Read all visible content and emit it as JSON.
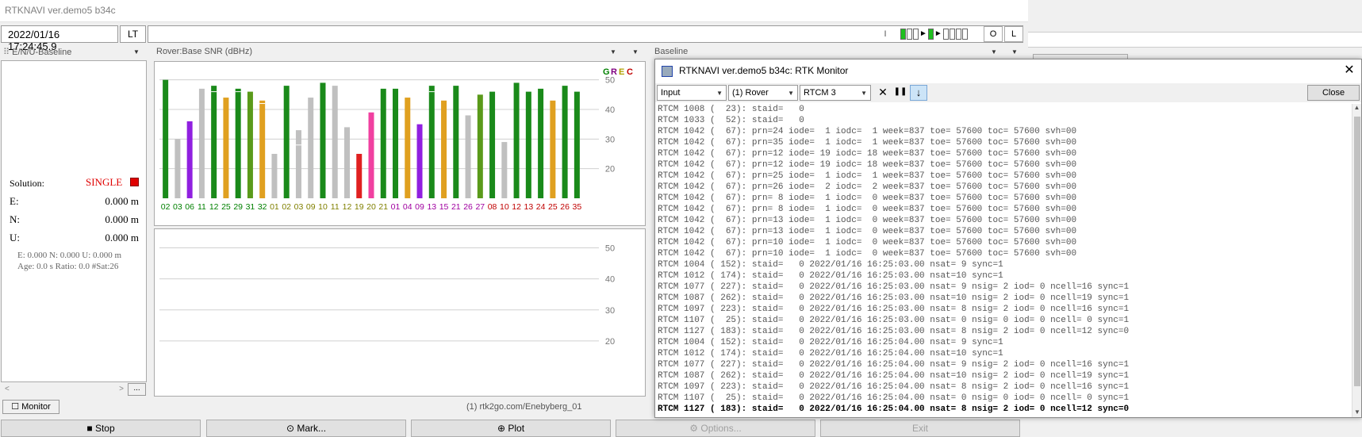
{
  "main_title": "RTKNAVI ver.demo5 b34c",
  "datetime": "2022/01/16 17:24:45.9",
  "time_mode": "LT",
  "status_btn": "I",
  "o_btn": "O",
  "l_btn": "L",
  "left_panel_title": "E/N/U-Baseline",
  "solution_label": "Solution:",
  "solution_value": "SINGLE",
  "e_label": "E:",
  "e_value": "0.000 m",
  "n_label": "N:",
  "n_value": "0.000 m",
  "u_label": "U:",
  "u_value": "0.000 m",
  "info_line1": "E: 0.000 N: 0.000 U: 0.000 m",
  "info_line2": "Age: 0.0 s Ratio: 0.0 #Sat:26",
  "more_btn": "...",
  "snr_title": "Rover:Base  SNR (dBHz)",
  "baseline_title": "Baseline",
  "monitor_btn": "Monitor",
  "stream_info": "(1) rtk2go.com/Enebyberg_01",
  "buttons": {
    "stop": "Stop",
    "mark": "Mark...",
    "plot": "Plot",
    "options": "Options...",
    "exit": "Exit"
  },
  "monitor": {
    "title": "RTKNAVI ver.demo5 b34c: RTK Monitor",
    "input_sel": "Input",
    "rover_sel": "(1) Rover",
    "format_sel": "RTCM 3",
    "close_btn": "Close",
    "log": [
      "RTCM 1008 (  23): staid=   0",
      "RTCM 1033 (  52): staid=   0",
      "RTCM 1042 (  67): prn=24 iode=  1 iodc=  1 week=837 toe= 57600 toc= 57600 svh=00",
      "RTCM 1042 (  67): prn=35 iode=  1 iodc=  1 week=837 toe= 57600 toc= 57600 svh=00",
      "RTCM 1042 (  67): prn=12 iode= 19 iodc= 18 week=837 toe= 57600 toc= 57600 svh=00",
      "RTCM 1042 (  67): prn=12 iode= 19 iodc= 18 week=837 toe= 57600 toc= 57600 svh=00",
      "RTCM 1042 (  67): prn=25 iode=  1 iodc=  1 week=837 toe= 57600 toc= 57600 svh=00",
      "RTCM 1042 (  67): prn=26 iode=  2 iodc=  2 week=837 toe= 57600 toc= 57600 svh=00",
      "RTCM 1042 (  67): prn= 8 iode=  1 iodc=  0 week=837 toe= 57600 toc= 57600 svh=00",
      "RTCM 1042 (  67): prn= 8 iode=  1 iodc=  0 week=837 toe= 57600 toc= 57600 svh=00",
      "RTCM 1042 (  67): prn=13 iode=  1 iodc=  0 week=837 toe= 57600 toc= 57600 svh=00",
      "RTCM 1042 (  67): prn=13 iode=  1 iodc=  0 week=837 toe= 57600 toc= 57600 svh=00",
      "RTCM 1042 (  67): prn=10 iode=  1 iodc=  0 week=837 toe= 57600 toc= 57600 svh=00",
      "RTCM 1042 (  67): prn=10 iode=  1 iodc=  0 week=837 toe= 57600 toc= 57600 svh=00",
      "RTCM 1004 ( 152): staid=   0 2022/01/16 16:25:03.00 nsat= 9 sync=1",
      "RTCM 1012 ( 174): staid=   0 2022/01/16 16:25:03.00 nsat=10 sync=1",
      "RTCM 1077 ( 227): staid=   0 2022/01/16 16:25:03.00 nsat= 9 nsig= 2 iod= 0 ncell=16 sync=1",
      "RTCM 1087 ( 262): staid=   0 2022/01/16 16:25:03.00 nsat=10 nsig= 2 iod= 0 ncell=19 sync=1",
      "RTCM 1097 ( 223): staid=   0 2022/01/16 16:25:03.00 nsat= 8 nsig= 2 iod= 0 ncell=16 sync=1",
      "RTCM 1107 (  25): staid=   0 2022/01/16 16:25:03.00 nsat= 0 nsig= 0 iod= 0 ncell= 0 sync=1",
      "RTCM 1127 ( 183): staid=   0 2022/01/16 16:25:03.00 nsat= 8 nsig= 2 iod= 0 ncell=12 sync=0",
      "RTCM 1004 ( 152): staid=   0 2022/01/16 16:25:04.00 nsat= 9 sync=1",
      "RTCM 1012 ( 174): staid=   0 2022/01/16 16:25:04.00 nsat=10 sync=1",
      "RTCM 1077 ( 227): staid=   0 2022/01/16 16:25:04.00 nsat= 9 nsig= 2 iod= 0 ncell=16 sync=1",
      "RTCM 1087 ( 262): staid=   0 2022/01/16 16:25:04.00 nsat=10 nsig= 2 iod= 0 ncell=19 sync=1",
      "RTCM 1097 ( 223): staid=   0 2022/01/16 16:25:04.00 nsat= 8 nsig= 2 iod= 0 ncell=16 sync=1",
      "RTCM 1107 (  25): staid=   0 2022/01/16 16:25:04.00 nsat= 0 nsig= 0 iod= 0 ncell= 0 sync=1",
      "RTCM 1127 ( 183): staid=   0 2022/01/16 16:25:04.00 nsat= 8 nsig= 2 iod= 0 ncell=12 sync=0"
    ]
  },
  "chart_data": {
    "type": "bar",
    "title": "Rover:Base  SNR (dBHz)",
    "legend": [
      "G",
      "R",
      "E",
      "C"
    ],
    "legend_colors": [
      "#008000",
      "#800080",
      "#b0a000",
      "#c00000"
    ],
    "ylim": [
      10,
      55
    ],
    "y_ticks": [
      20,
      30,
      40,
      50
    ],
    "grid": true,
    "categories": [
      "02",
      "03",
      "06",
      "11",
      "12",
      "25",
      "29",
      "31",
      "32",
      "01",
      "02",
      "03",
      "09",
      "10",
      "11",
      "12",
      "19",
      "20",
      "21",
      "01",
      "04",
      "09",
      "13",
      "15",
      "21",
      "26",
      "27",
      "08",
      "10",
      "12",
      "13",
      "24",
      "25",
      "26",
      "35"
    ],
    "label_colors": [
      "#008000",
      "#008000",
      "#008000",
      "#008000",
      "#008000",
      "#008000",
      "#008000",
      "#008000",
      "#008000",
      "#808000",
      "#808000",
      "#808000",
      "#808000",
      "#808000",
      "#808000",
      "#808000",
      "#808000",
      "#808000",
      "#808000",
      "#a000a0",
      "#a000a0",
      "#a000a0",
      "#a000a0",
      "#a000a0",
      "#a000a0",
      "#a000a0",
      "#a000a0",
      "#c00000",
      "#c00000",
      "#c00000",
      "#c00000",
      "#c00000",
      "#c00000",
      "#c00000",
      "#c00000"
    ],
    "values": [
      50,
      30,
      36,
      47,
      48,
      44,
      47,
      46,
      43,
      25,
      48,
      33,
      44,
      49,
      48,
      34,
      25,
      39,
      47,
      47,
      44,
      35,
      48,
      43,
      48,
      38,
      45,
      46,
      29,
      49,
      46,
      47,
      43,
      48,
      46
    ],
    "bar_colors": [
      "#1a8a1a",
      "#c0c0c0",
      "#9020e0",
      "#c0c0c0",
      "#1a8a1a",
      "#e0a020",
      "#1a8a1a",
      "#5a9a1a",
      "#e0a020",
      "#c0c0c0",
      "#1a8a1a",
      "#c0c0c0",
      "#c0c0c0",
      "#1a8a1a",
      "#c0c0c0",
      "#c0c0c0",
      "#e02020",
      "#f040a0",
      "#1a8a1a",
      "#1a8a1a",
      "#e0a020",
      "#9020e0",
      "#1a8a1a",
      "#e0a020",
      "#1a8a1a",
      "#c0c0c0",
      "#5a9a1a",
      "#1a8a1a",
      "#c0c0c0",
      "#1a8a1a",
      "#1a8a1a",
      "#1a8a1a",
      "#e0a020",
      "#1a8a1a",
      "#1a8a1a"
    ],
    "base_values": [
      null,
      null,
      null,
      null,
      46,
      null,
      46,
      null,
      42,
      null,
      null,
      28,
      null,
      null,
      null,
      null,
      null,
      null,
      null,
      null,
      null,
      null,
      46,
      null,
      null,
      null,
      null,
      null,
      null,
      null,
      null,
      null,
      null,
      null,
      null
    ]
  }
}
